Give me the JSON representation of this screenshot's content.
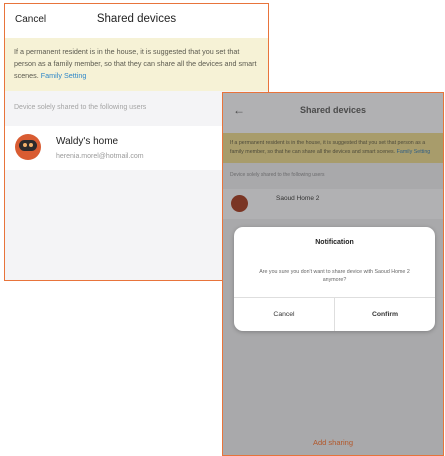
{
  "screen_a": {
    "header": {
      "cancel_label": "Cancel",
      "title": "Shared devices"
    },
    "notice": {
      "text": "If a permanent resident is in the house, it is suggested that you set that person as a family member, so that they can share all the devices and smart scenes.",
      "link": "Family Setting"
    },
    "section_label": "Device solely shared to the following users",
    "user": {
      "name": "Waldy's home",
      "email": "herenia.morel@hotmail.com"
    }
  },
  "screen_b": {
    "header": {
      "back_icon": "←",
      "title": "Shared devices"
    },
    "notice": {
      "text": "If a permanent resident is in the house, it is suggested that you set that person as a family member, so that he can share all the devices and smart scenes.",
      "link": "Family Setting"
    },
    "section_label": "Device solely shared to the following users",
    "user": {
      "name": "Saoud Home 2"
    },
    "add_sharing": "Add sharing",
    "dialog": {
      "title": "Notification",
      "message": "Are you sure you don't want to share device with Saoud Home 2 anymore?",
      "cancel_label": "Cancel",
      "confirm_label": "Confirm"
    }
  },
  "colors": {
    "accent_orange": "#e8743b",
    "link_blue": "#2f87c8",
    "notice_bg": "#f6f2d6"
  }
}
